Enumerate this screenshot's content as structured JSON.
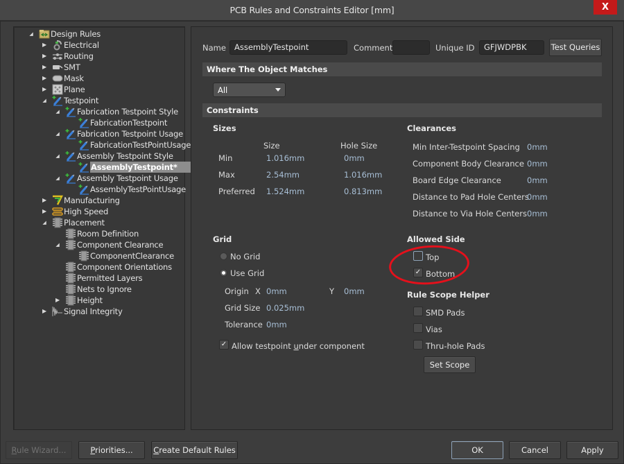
{
  "window": {
    "title": "PCB Rules and Constraints Editor [mm]",
    "close_label": "X"
  },
  "tree": {
    "items": [
      {
        "label": "Design Rules",
        "level": 0,
        "expander": "expanded",
        "icon": "design-rules-folder-icon"
      },
      {
        "label": "Electrical",
        "level": 1,
        "expander": "collapsed",
        "icon": "electrical-icon"
      },
      {
        "label": "Routing",
        "level": 1,
        "expander": "collapsed",
        "icon": "routing-icon"
      },
      {
        "label": "SMT",
        "level": 1,
        "expander": "collapsed",
        "icon": "smt-icon"
      },
      {
        "label": "Mask",
        "level": 1,
        "expander": "collapsed",
        "icon": "mask-icon"
      },
      {
        "label": "Plane",
        "level": 1,
        "expander": "collapsed",
        "icon": "plane-icon"
      },
      {
        "label": "Testpoint",
        "level": 1,
        "expander": "expanded",
        "icon": "testpoint-icon"
      },
      {
        "label": "Fabrication Testpoint Style",
        "level": 2,
        "expander": "expanded",
        "icon": "testpoint-icon"
      },
      {
        "label": "FabricationTestpoint",
        "level": 3,
        "expander": "none",
        "icon": "testpoint-icon"
      },
      {
        "label": "Fabrication Testpoint Usage",
        "level": 2,
        "expander": "expanded",
        "icon": "testpoint-icon"
      },
      {
        "label": "FabricationTestPointUsage",
        "level": 3,
        "expander": "none",
        "icon": "testpoint-icon"
      },
      {
        "label": "Assembly Testpoint Style",
        "level": 2,
        "expander": "expanded",
        "icon": "testpoint-icon"
      },
      {
        "label": "AssemblyTestpoint*",
        "level": 3,
        "expander": "none",
        "icon": "testpoint-icon",
        "selected": true
      },
      {
        "label": "Assembly Testpoint Usage",
        "level": 2,
        "expander": "expanded",
        "icon": "testpoint-icon"
      },
      {
        "label": "AssemblyTestPointUsage",
        "level": 3,
        "expander": "none",
        "icon": "testpoint-icon"
      },
      {
        "label": "Manufacturing",
        "level": 1,
        "expander": "collapsed",
        "icon": "manufacturing-icon"
      },
      {
        "label": "High Speed",
        "level": 1,
        "expander": "collapsed",
        "icon": "high-speed-icon"
      },
      {
        "label": "Placement",
        "level": 1,
        "expander": "expanded",
        "icon": "placement-icon"
      },
      {
        "label": "Room Definition",
        "level": 2,
        "expander": "none",
        "icon": "placement-icon"
      },
      {
        "label": "Component Clearance",
        "level": 2,
        "expander": "expanded",
        "icon": "placement-icon"
      },
      {
        "label": "ComponentClearance",
        "level": 3,
        "expander": "none",
        "icon": "placement-icon"
      },
      {
        "label": "Component Orientations",
        "level": 2,
        "expander": "none",
        "icon": "placement-icon"
      },
      {
        "label": "Permitted Layers",
        "level": 2,
        "expander": "none",
        "icon": "placement-icon"
      },
      {
        "label": "Nets to Ignore",
        "level": 2,
        "expander": "none",
        "icon": "placement-icon"
      },
      {
        "label": "Height",
        "level": 2,
        "expander": "collapsed",
        "icon": "placement-icon"
      },
      {
        "label": "Signal Integrity",
        "level": 1,
        "expander": "collapsed",
        "icon": "signal-integrity-icon"
      }
    ]
  },
  "rule": {
    "name_label": "Name",
    "name_value": "AssemblyTestpoint",
    "comment_label": "Comment",
    "comment_value": "",
    "unique_id_label": "Unique ID",
    "unique_id_value": "GFJWDPBK",
    "test_queries_label": "Test Queries"
  },
  "where": {
    "header": "Where The Object Matches",
    "selected": "All"
  },
  "constraints": {
    "header": "Constraints",
    "sizes": {
      "title": "Sizes",
      "col_size": "Size",
      "col_hole": "Hole Size",
      "rows": [
        {
          "label": "Min",
          "size": "1.016mm",
          "hole": "0mm"
        },
        {
          "label": "Max",
          "size": "2.54mm",
          "hole": "1.016mm"
        },
        {
          "label": "Preferred",
          "size": "1.524mm",
          "hole": "0.813mm"
        }
      ]
    },
    "clearances": {
      "title": "Clearances",
      "rows": [
        {
          "label": "Min Inter-Testpoint Spacing",
          "value": "0mm"
        },
        {
          "label": "Component Body Clearance",
          "value": "0mm"
        },
        {
          "label": "Board Edge Clearance",
          "value": "0mm"
        },
        {
          "label": "Distance to Pad Hole Centers",
          "value": "0mm"
        },
        {
          "label": "Distance to Via Hole Centers",
          "value": "0mm"
        }
      ]
    },
    "grid": {
      "title": "Grid",
      "no_grid": "No Grid",
      "use_grid": "Use Grid",
      "selected": "Use Grid",
      "origin_label": "Origin",
      "x_label": "X",
      "x_value": "0mm",
      "y_label": "Y",
      "y_value": "0mm",
      "grid_size_label": "Grid Size",
      "grid_size_value": "0.025mm",
      "tolerance_label": "Tolerance",
      "tolerance_value": "0mm",
      "allow_under_pre": "Allow testpoint ",
      "allow_under_u": "u",
      "allow_under_post": "nder component",
      "allow_under_checked": true
    },
    "allowed_side": {
      "title": "Allowed Side",
      "top": "Top",
      "top_checked": false,
      "bottom": "Bottom",
      "bottom_checked": true
    },
    "scope_helper": {
      "title": "Rule Scope Helper",
      "smd_pads": "SMD Pads",
      "vias": "Vias",
      "thru_hole_pads": "Thru-hole Pads",
      "set_scope": "Set Scope"
    }
  },
  "annotation": {
    "highlight_color": "#e5101b",
    "target": "Allowed Side"
  },
  "footer": {
    "rule_wizard_u": "R",
    "rule_wizard_rest": "ule Wizard...",
    "priorities_u": "P",
    "priorities_rest": "riorities...",
    "create_default_u": "C",
    "create_default_rest": "reate Default Rules",
    "ok": "OK",
    "cancel": "Cancel",
    "apply": "Apply"
  }
}
